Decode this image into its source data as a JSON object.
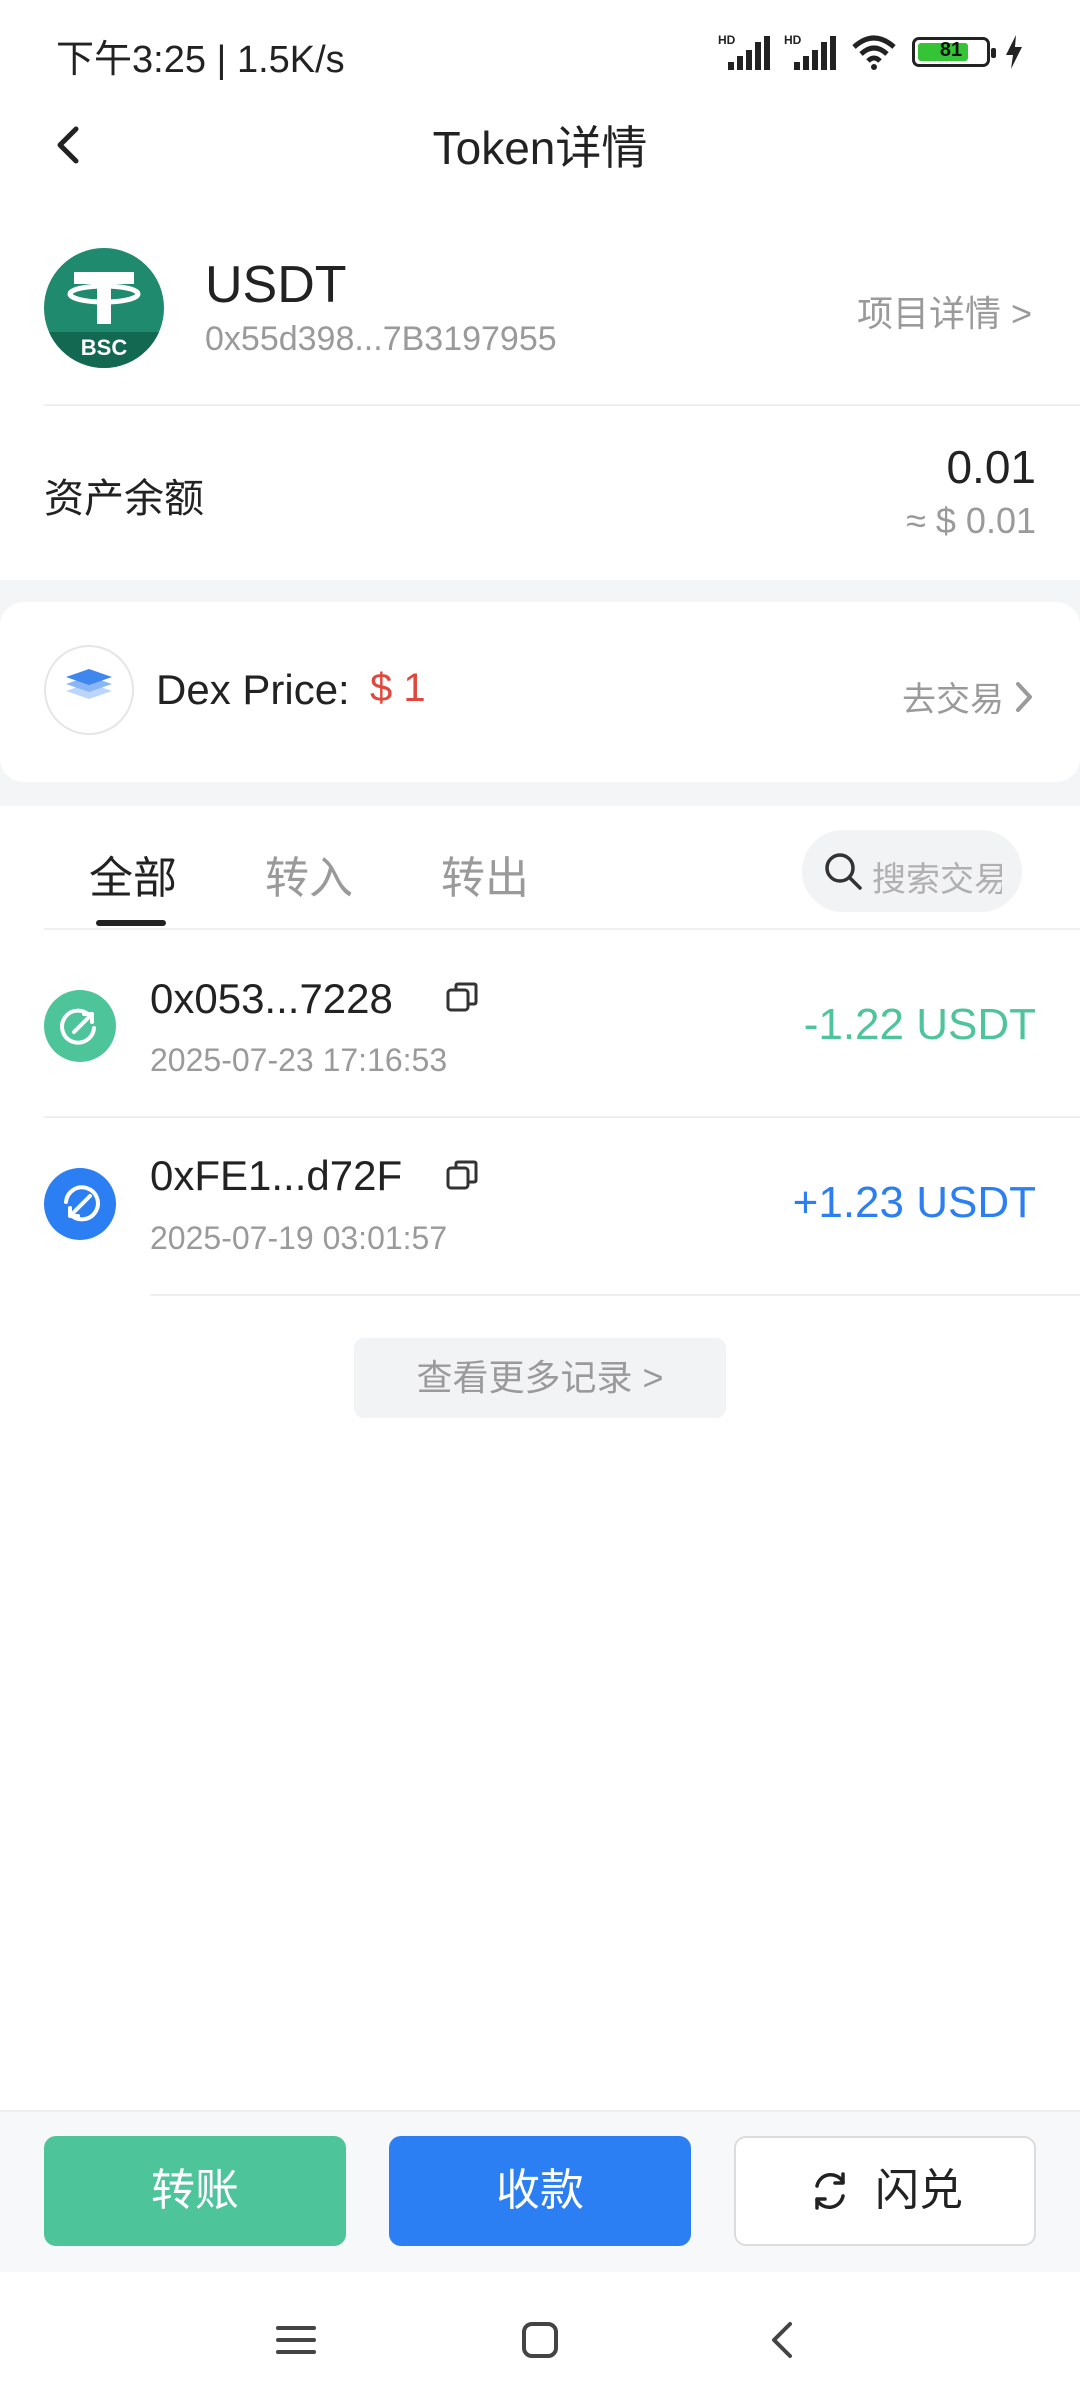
{
  "status_bar": {
    "time": "下午3:25 | 1.5K/s",
    "battery": "81",
    "signal_label": "HD",
    "icons": [
      "signal-hd-icon",
      "signal-hd-icon",
      "wifi-icon",
      "battery-icon",
      "charging-icon"
    ]
  },
  "header": {
    "title": "Token详情",
    "back_icon": "chevron-left-icon"
  },
  "token": {
    "symbol": "USDT",
    "chain_badge": "BSC",
    "address": "0x55d398...7B3197955",
    "project_link": "项目详情 >"
  },
  "balance": {
    "label": "资产余额",
    "amount": "0.01",
    "usd": "≈ $ 0.01"
  },
  "dex": {
    "label": "Dex Price:",
    "price": "$ 1",
    "trade_link": "去交易",
    "icon": "layers-icon"
  },
  "tabs": [
    {
      "label": "全部",
      "active": true
    },
    {
      "label": "转入",
      "active": false
    },
    {
      "label": "转出",
      "active": false
    }
  ],
  "search": {
    "placeholder": "搜索交易"
  },
  "transactions": [
    {
      "address": "0x053...7228",
      "time": "2025-07-23 17:16:53",
      "amount": "-1.22 USDT",
      "direction": "out",
      "color": "#4ec49a"
    },
    {
      "address": "0xFE1...d72F",
      "time": "2025-07-19 03:01:57",
      "amount": "+1.23 USDT",
      "direction": "in",
      "color": "#2b7ff2"
    }
  ],
  "more_records": "查看更多记录 >",
  "actions": {
    "transfer": "转账",
    "receive": "收款",
    "swap": "闪兑"
  },
  "colors": {
    "green": "#4ec49a",
    "blue": "#2b7ff2",
    "red": "#e0483d",
    "token_green": "#1f8a6e"
  }
}
